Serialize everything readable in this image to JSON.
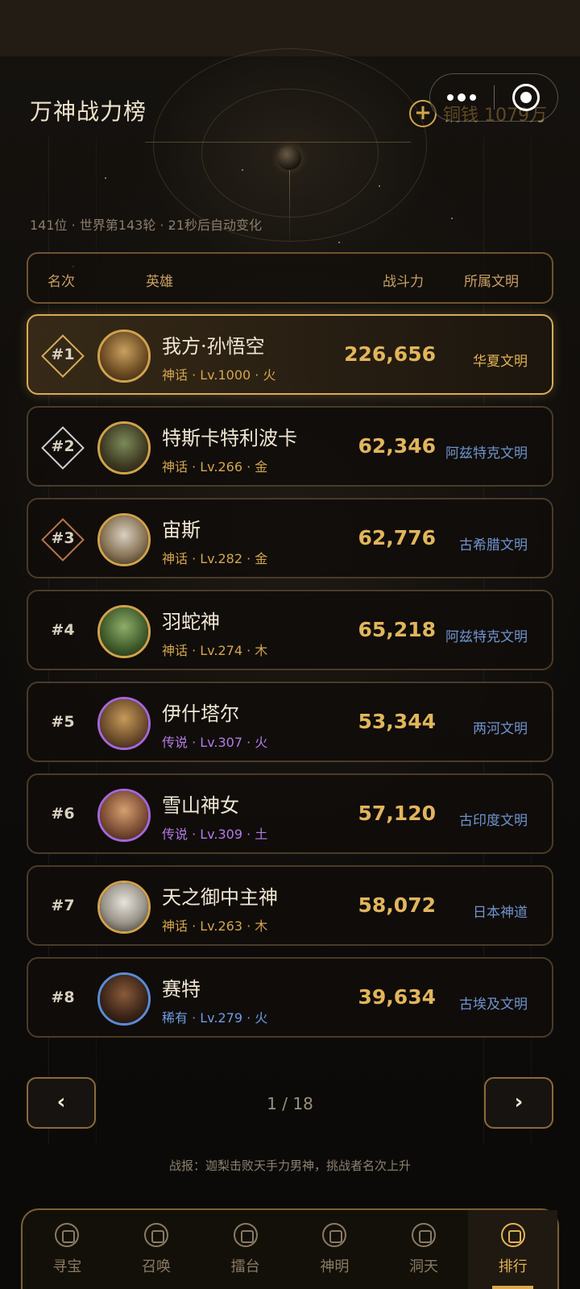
{
  "title": "万神战力榜",
  "currency": {
    "plus": "+",
    "label": "铜钱 1079万"
  },
  "subline": "141位 · 世界第143轮 · 21秒后自动变化",
  "table_headers": {
    "rank": "名次",
    "hero": "英雄",
    "power": "战斗力",
    "civ": "所属文明"
  },
  "rows": [
    {
      "rank": "#1",
      "name": "我方·孙悟空",
      "meta": "神话 · Lv.1000 · 火",
      "power": "226,656",
      "civ": "华夏文明",
      "tier": "gold"
    },
    {
      "rank": "#2",
      "name": "特斯卡特利波卡",
      "meta": "神话 · Lv.266 · 金",
      "power": "62,346",
      "civ": "阿兹特克文明",
      "tier": "gold"
    },
    {
      "rank": "#3",
      "name": "宙斯",
      "meta": "神话 · Lv.282 · 金",
      "power": "62,776",
      "civ": "古希腊文明",
      "tier": "gold"
    },
    {
      "rank": "#4",
      "name": "羽蛇神",
      "meta": "神话 · Lv.274 · 木",
      "power": "65,218",
      "civ": "阿兹特克文明",
      "tier": "gold"
    },
    {
      "rank": "#5",
      "name": "伊什塔尔",
      "meta": "传说 · Lv.307 · 火",
      "power": "53,344",
      "civ": "两河文明",
      "tier": "purple"
    },
    {
      "rank": "#6",
      "name": "雪山神女",
      "meta": "传说 · Lv.309 · 土",
      "power": "57,120",
      "civ": "古印度文明",
      "tier": "purple"
    },
    {
      "rank": "#7",
      "name": "天之御中主神",
      "meta": "神话 · Lv.263 · 木",
      "power": "58,072",
      "civ": "日本神道",
      "tier": "gold"
    },
    {
      "rank": "#8",
      "name": "赛特",
      "meta": "稀有 · Lv.279 · 火",
      "power": "39,634",
      "civ": "古埃及文明",
      "tier": "blue"
    }
  ],
  "pagination": {
    "prev": "‹",
    "next": "›",
    "info": "1 / 18"
  },
  "report": "战报：迦梨击败天手力男神，挑战者名次上升",
  "tabs": [
    {
      "label": "寻宝",
      "icon": "treasure-icon"
    },
    {
      "label": "召唤",
      "icon": "summon-icon"
    },
    {
      "label": "擂台",
      "icon": "arena-icon"
    },
    {
      "label": "神明",
      "icon": "deity-icon"
    },
    {
      "label": "洞天",
      "icon": "cave-icon"
    },
    {
      "label": "排行",
      "icon": "ranking-icon"
    }
  ],
  "colors": {
    "accent": "#d7ac56",
    "civ_blue": "#6f94cc",
    "legend": "#b37be6",
    "rare": "#6f9be0"
  }
}
